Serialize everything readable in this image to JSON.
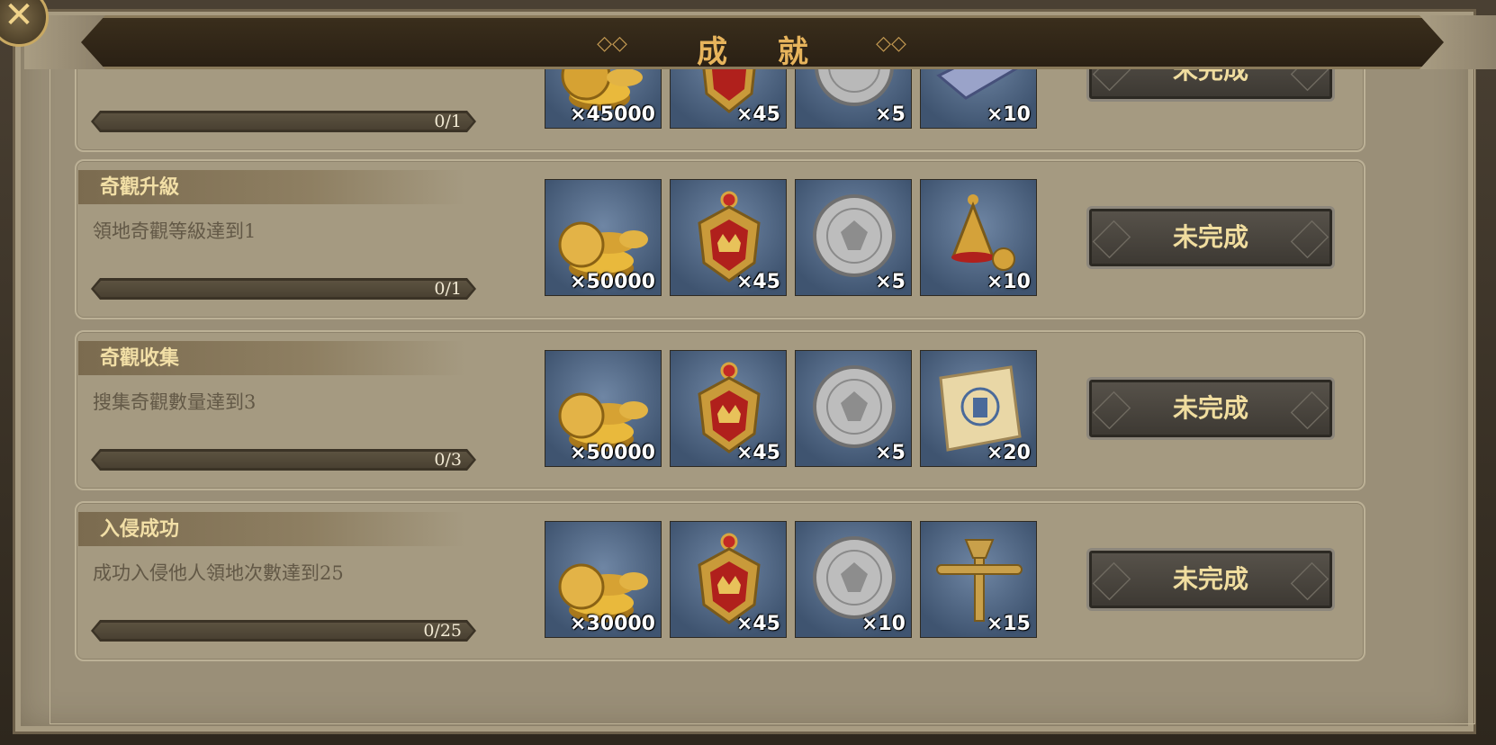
{
  "header": {
    "title": "成 就",
    "close_icon": "close-x-icon"
  },
  "achievements": [
    {
      "title": "",
      "description": "",
      "progress_text": "0/1",
      "progress": 0,
      "rewards": [
        {
          "icon": "gold-coins-icon",
          "qty": "×45000"
        },
        {
          "icon": "crest-badge-icon",
          "qty": "×45"
        },
        {
          "icon": "silver-coin-icon",
          "qty": "×5"
        },
        {
          "icon": "silver-bar-icon",
          "qty": "×10"
        }
      ],
      "status": "未完成"
    },
    {
      "title": "奇觀升級",
      "description": "領地奇觀等級達到1",
      "progress_text": "0/1",
      "progress": 0,
      "rewards": [
        {
          "icon": "gold-coins-icon",
          "qty": "×50000"
        },
        {
          "icon": "crest-badge-icon",
          "qty": "×45"
        },
        {
          "icon": "silver-coin-icon",
          "qty": "×5"
        },
        {
          "icon": "golden-bell-icon",
          "qty": "×10"
        }
      ],
      "status": "未完成"
    },
    {
      "title": "奇觀收集",
      "description": "搜集奇觀數量達到3",
      "progress_text": "0/3",
      "progress": 0,
      "rewards": [
        {
          "icon": "gold-coins-icon",
          "qty": "×50000"
        },
        {
          "icon": "crest-badge-icon",
          "qty": "×45"
        },
        {
          "icon": "silver-coin-icon",
          "qty": "×5"
        },
        {
          "icon": "scroll-icon",
          "qty": "×20"
        }
      ],
      "status": "未完成"
    },
    {
      "title": "入侵成功",
      "description": "成功入侵他人領地次數達到25",
      "progress_text": "0/25",
      "progress": 0,
      "rewards": [
        {
          "icon": "gold-coins-icon",
          "qty": "×30000"
        },
        {
          "icon": "crest-badge-icon",
          "qty": "×45"
        },
        {
          "icon": "silver-coin-icon",
          "qty": "×10"
        },
        {
          "icon": "brass-trumpet-icon",
          "qty": "×15"
        }
      ],
      "status": "未完成"
    }
  ],
  "colors": {
    "title_gold": "#e7b45c",
    "button_text": "#f0dd9f",
    "panel": "#9a8f78"
  }
}
